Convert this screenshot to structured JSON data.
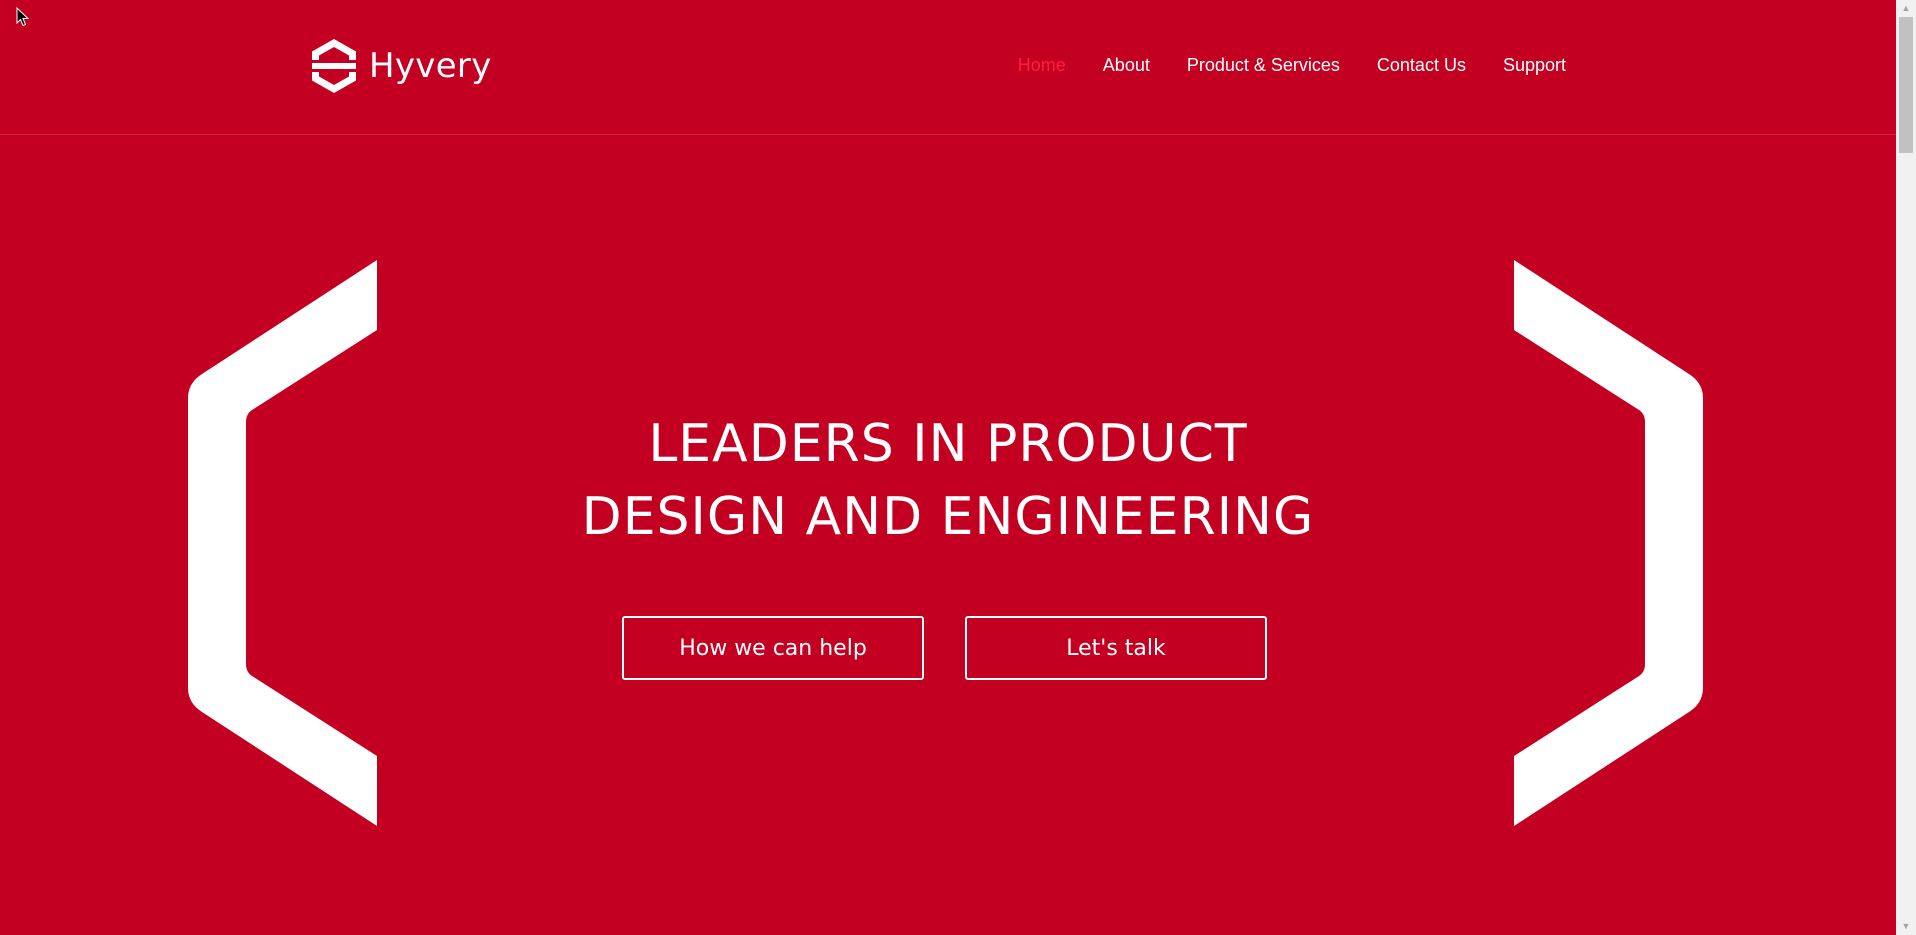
{
  "brand": {
    "name": "Hyvery",
    "logo_icon": "hexagon-h-logo-icon"
  },
  "nav": {
    "items": [
      {
        "label": "Home",
        "active": true
      },
      {
        "label": "About",
        "active": false
      },
      {
        "label": "Product & Services",
        "active": false
      },
      {
        "label": "Contact Us",
        "active": false
      },
      {
        "label": "Support",
        "active": false
      }
    ]
  },
  "hero": {
    "title_line1": "LEADERS IN PRODUCT",
    "title_line2": "DESIGN AND ENGINEERING",
    "primary_button": "How we can help",
    "secondary_button": "Let's talk",
    "decoration_icons": [
      "left-bracket-shape-icon",
      "right-bracket-shape-icon"
    ]
  },
  "colors": {
    "background": "#c30022",
    "text": "#ffffff",
    "nav_active": "#ff1f3d"
  }
}
